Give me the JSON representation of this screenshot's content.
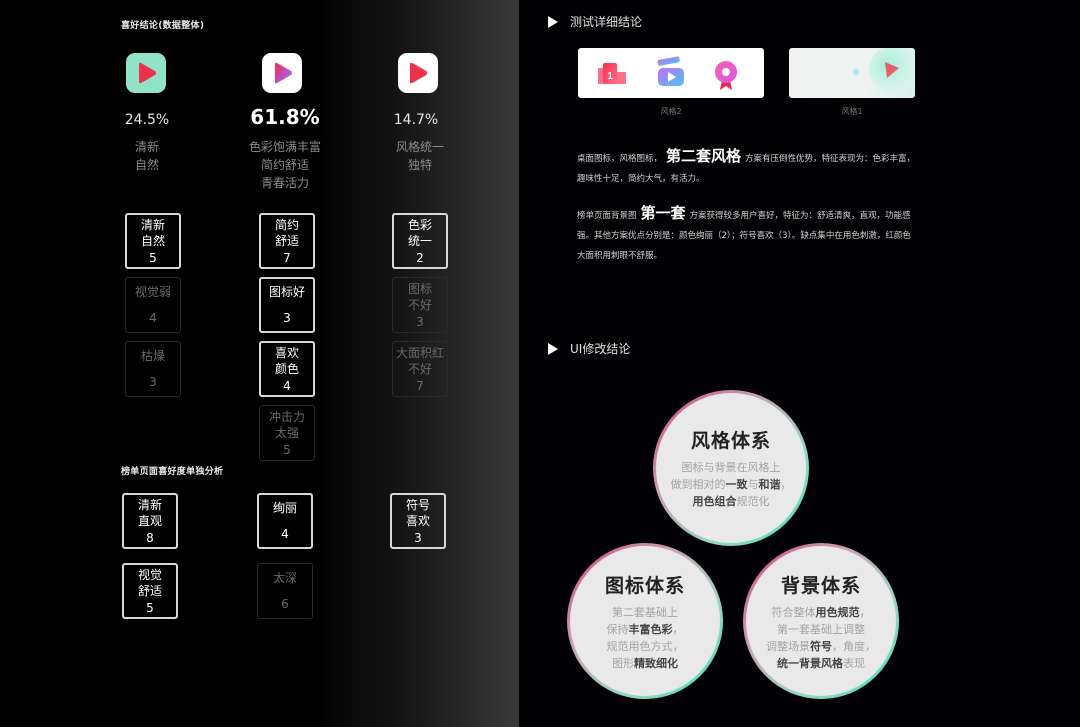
{
  "left": {
    "overall_title": "喜好结论(数据整体)",
    "styles": [
      {
        "percent": "24.5%",
        "desc": [
          "清新",
          "自然"
        ],
        "icon": "play-icon-mint"
      },
      {
        "percent": "61.8%",
        "desc": [
          "色彩饱满丰富",
          "简约舒适",
          "青春活力"
        ],
        "icon": "play-icon-gradient"
      },
      {
        "percent": "14.7%",
        "desc": [
          "风格统一",
          "独特"
        ],
        "icon": "play-icon-red"
      }
    ],
    "overall_tags": [
      [
        {
          "lines": [
            "清新",
            "自然"
          ],
          "count": "5",
          "strong": true
        },
        {
          "lines": [
            "视觉弱"
          ],
          "count": "4",
          "strong": false
        },
        {
          "lines": [
            "枯燥"
          ],
          "count": "3",
          "strong": false
        }
      ],
      [
        {
          "lines": [
            "简约",
            "舒适"
          ],
          "count": "7",
          "strong": true
        },
        {
          "lines": [
            "图标好"
          ],
          "count": "3",
          "strong": true
        },
        {
          "lines": [
            "喜欢",
            "颜色"
          ],
          "count": "4",
          "strong": true
        },
        {
          "lines": [
            "冲击力",
            "太强"
          ],
          "count": "5",
          "strong": false
        }
      ],
      [
        {
          "lines": [
            "色彩",
            "统一"
          ],
          "count": "2",
          "strong": true
        },
        {
          "lines": [
            "图标",
            "不好"
          ],
          "count": "3",
          "strong": false
        },
        {
          "lines": [
            "大面积红",
            "不好"
          ],
          "count": "7",
          "strong": false
        }
      ]
    ],
    "ranking_title": "榜单页面喜好度单独分析",
    "ranking_tags": [
      [
        {
          "lines": [
            "清新",
            "直观"
          ],
          "count": "8",
          "strong": true
        },
        {
          "lines": [
            "视觉",
            "舒适"
          ],
          "count": "5",
          "strong": true
        }
      ],
      [
        {
          "lines": [
            "绚丽"
          ],
          "count": "4",
          "strong": true
        },
        {
          "lines": [
            "太深"
          ],
          "count": "6",
          "strong": false
        }
      ],
      [
        {
          "lines": [
            "符号",
            "喜欢"
          ],
          "count": "3",
          "strong": true
        }
      ]
    ]
  },
  "right": {
    "detail_title": "测试详细结论",
    "cards": [
      {
        "label": "风格2",
        "icons": [
          "rank-1-icon",
          "clapperboard-play-icon",
          "medal-icon"
        ]
      },
      {
        "label": "风格1",
        "icons": [
          "heart-bubble-icon",
          "play-circle-icon"
        ]
      }
    ],
    "para1": {
      "pre": "桌面图标，风格图标，",
      "big": "第二套风格",
      "post": "方案有压倒性优势，特征表现为：色彩丰富，趣味性十足，简约大气，有活力。"
    },
    "para2": {
      "pre": "榜单页面背景图",
      "big": "第一套",
      "post": "方案获得较多用户喜好，特征为：舒适清爽，直观，功能感强。其他方案优点分别是：颜色绚丽（2）；符号喜欢（3）。缺点集中在用色刺激，红颜色大面积用刺眼不舒服。"
    },
    "ui_title": "UI修改结论",
    "circles": [
      {
        "title": "风格体系",
        "lines": [
          [
            {
              "t": "图标与背景在风格上",
              "b": false
            }
          ],
          [
            {
              "t": "做到相对的",
              "b": false
            },
            {
              "t": "一致",
              "b": true
            },
            {
              "t": "与",
              "b": false
            },
            {
              "t": "和谐",
              "b": true
            },
            {
              "t": "，",
              "b": false
            }
          ],
          [
            {
              "t": "用色组合",
              "b": true
            },
            {
              "t": "规范化",
              "b": false
            }
          ]
        ]
      },
      {
        "title": "图标体系",
        "lines": [
          [
            {
              "t": "第二套基础上",
              "b": false
            }
          ],
          [
            {
              "t": "保持",
              "b": false
            },
            {
              "t": "丰富色彩",
              "b": true
            },
            {
              "t": "，",
              "b": false
            }
          ],
          [
            {
              "t": "规范用色方式，",
              "b": false
            }
          ],
          [
            {
              "t": "图形",
              "b": false
            },
            {
              "t": "精致细化",
              "b": true
            }
          ]
        ]
      },
      {
        "title": "背景体系",
        "lines": [
          [
            {
              "t": "符合整体",
              "b": false
            },
            {
              "t": "用色规范",
              "b": true
            },
            {
              "t": "，",
              "b": false
            }
          ],
          [
            {
              "t": "第一套基础上调整",
              "b": false
            }
          ],
          [
            {
              "t": "调整场景",
              "b": false
            },
            {
              "t": "符号",
              "b": true
            },
            {
              "t": "，角度，",
              "b": false
            }
          ],
          [
            {
              "t": "统一背景风格",
              "b": true
            },
            {
              "t": "表现",
              "b": false
            }
          ]
        ]
      }
    ]
  },
  "colors": {
    "mint": "#8fe3c6",
    "play_red": "#f0314a",
    "accent_pink": "#d6457c",
    "accent_teal": "#3fe0b0"
  }
}
